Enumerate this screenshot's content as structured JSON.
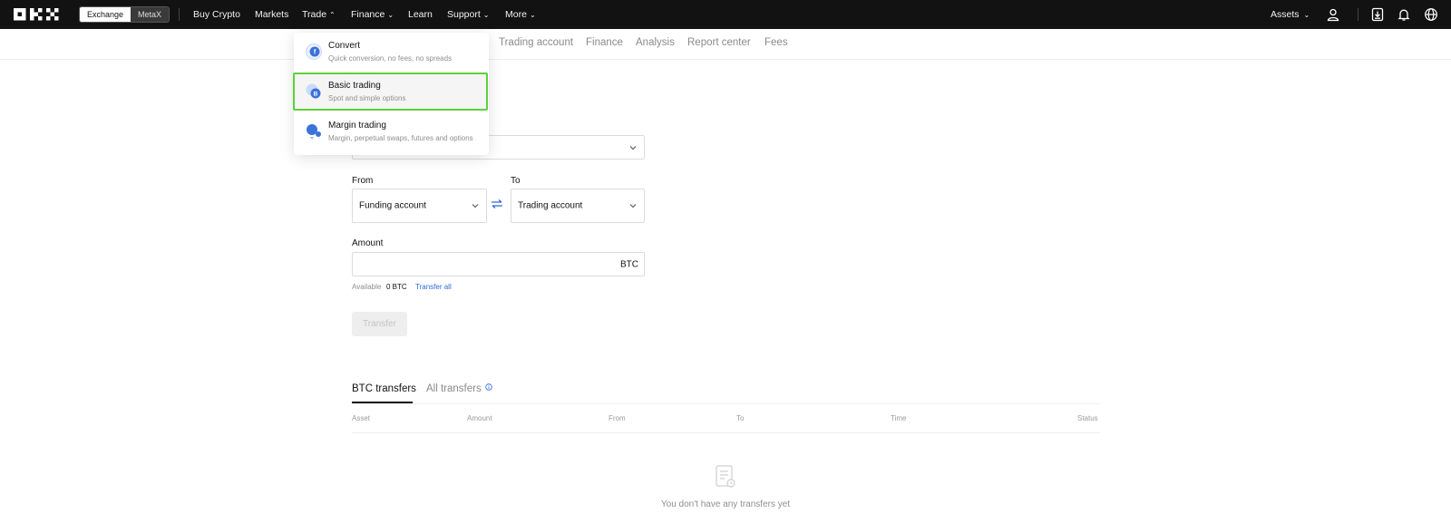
{
  "topbar": {
    "segment": {
      "exchange": "Exchange",
      "metax": "MetaX"
    },
    "nav": [
      "Buy Crypto",
      "Markets",
      "Trade",
      "Finance",
      "Learn",
      "Support",
      "More"
    ],
    "assets": "Assets"
  },
  "subnav": [
    "Trading account",
    "Finance",
    "Analysis",
    "Report center",
    "Fees"
  ],
  "dropdown": [
    {
      "title": "Convert",
      "subtitle": "Quick conversion, no fees, no spreads"
    },
    {
      "title": "Basic trading",
      "subtitle": "Spot and simple options"
    },
    {
      "title": "Margin trading",
      "subtitle": "Margin, perpetual swaps, futures and options"
    }
  ],
  "form": {
    "from_label": "From",
    "to_label": "To",
    "from_value": "Funding account",
    "to_value": "Trading account",
    "amount_label": "Amount",
    "amount_unit": "BTC",
    "available_label": "Available",
    "available_value": "0 BTC",
    "transfer_all": "Transfer all",
    "transfer_button": "Transfer"
  },
  "tabs": {
    "btc": "BTC transfers",
    "all": "All transfers"
  },
  "table": {
    "columns": [
      "Asset",
      "Amount",
      "From",
      "To",
      "Time",
      "Status"
    ]
  },
  "empty_text": "You don't have any transfers yet",
  "colors": {
    "accent": "#2c6ad6",
    "highlight": "#5ad33a",
    "topbar": "#121212"
  }
}
